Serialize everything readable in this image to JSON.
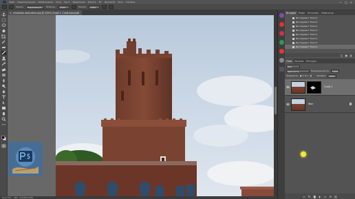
{
  "menubar": {
    "items": [
      "Файл",
      "Редактирование",
      "Изображение",
      "Слои",
      "Текст",
      "Выделение",
      "Фильтр",
      "3D",
      "Просмотр",
      "Окно",
      "Справка"
    ],
    "window_controls": [
      "—",
      "□",
      "×"
    ]
  },
  "options_bar": {
    "labels": [
      "Режим:",
      "Непрозр.:",
      "Нажим:"
    ],
    "mode_value": "Нормальный",
    "opacity_value": "100%",
    "flow_value": "100%",
    "sample_label": "Образец:"
  },
  "document": {
    "tab_title": "chromatic aberration.jpg @ 220% (Слой 1, Слой-маска/8)",
    "zoom": "220%"
  },
  "statusbar": {
    "zoom": "219,79%",
    "doc_info": "Док: 4,91M/9,82M"
  },
  "panels": {
    "history_tabs": [
      "История",
      "Инфо",
      "Источник",
      "Навигатор"
    ],
    "history_items": [
      "Инструмент \"Кисть\"",
      "Инструмент \"Кисть\"",
      "Инструмент \"Кисть\"",
      "Инструмент \"Кисть\"",
      "Инструмент \"Кисть\"",
      "Инструмент \"Кисть\"",
      "Инструмент \"Кисть\"",
      "Инструмент \"Кисть\""
    ],
    "layers_tabs": [
      "Слои",
      "Каналы",
      "Контуры"
    ],
    "filter_label": "Вид",
    "blend_mode": "Цветность",
    "opacity_label": "Непрозрачность:",
    "opacity_value": "100%",
    "lock_label": "Закрепить:",
    "fill_label": "Заливка:",
    "fill_value": "100%",
    "layers": [
      {
        "name": "Слой 1"
      },
      {
        "name": "Фон"
      }
    ]
  },
  "colors": {
    "accent_cursor": "#f2ea2c",
    "panel_bg": "#535353"
  }
}
